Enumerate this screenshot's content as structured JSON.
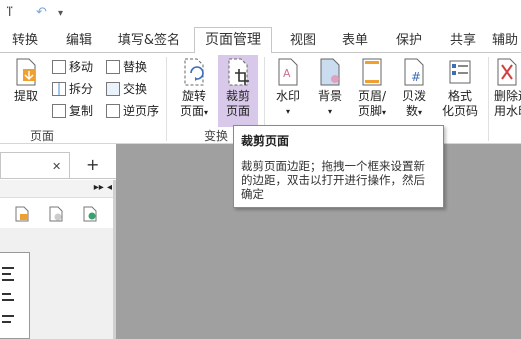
{
  "quick_access": {
    "hand_glyph": "ⴶ",
    "undo_glyph": "↶",
    "more_glyph": "▾"
  },
  "tabs": [
    {
      "label": "转换"
    },
    {
      "label": "编辑"
    },
    {
      "label": "填写&签名"
    },
    {
      "label": "页面管理"
    },
    {
      "label": "视图"
    },
    {
      "label": "表单"
    },
    {
      "label": "保护"
    },
    {
      "label": "共享"
    },
    {
      "label": "辅助"
    }
  ],
  "ribbon": {
    "extract": "提取",
    "move": "移动",
    "split": "拆分",
    "copy": "复制",
    "replace": "替换",
    "swap": "交换",
    "reverse": "逆页序",
    "group_page": "页面",
    "rotate_l1": "旋转",
    "rotate_l2": "页面",
    "crop_l1": "裁剪",
    "crop_l2": "页面",
    "group_transform": "变换",
    "watermark": "水印",
    "background": "背景",
    "header_l1": "页眉/",
    "header_l2": "页脚",
    "bates_l1": "贝泼",
    "bates_l2": "数",
    "format_l1": "格式",
    "format_l2": "化页码",
    "delete_l1": "删除远",
    "delete_l2": "用水印"
  },
  "tooltip": {
    "title": "裁剪页面",
    "desc": "裁剪页面边距；拖拽一个框来设置新的边距，双击以打开进行操作，然后确定"
  },
  "doc": {
    "close": "✕",
    "add": "+",
    "arrows": "▸▸ ◂"
  },
  "colors": {
    "highlight": "#d8c8ea",
    "workspace": "#a0a0a0"
  }
}
